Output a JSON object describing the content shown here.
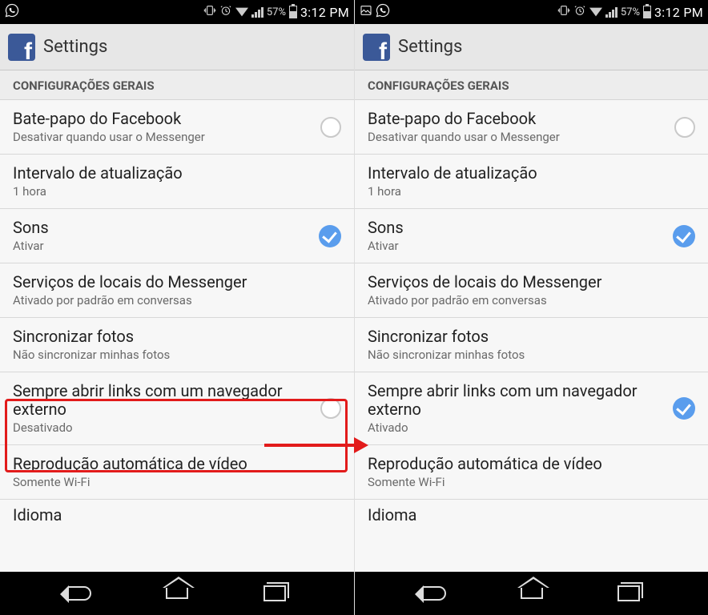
{
  "status": {
    "battery_pct": "57%",
    "time": "3:12 PM"
  },
  "header": {
    "title": "Settings"
  },
  "section_header": "CONFIGURAÇÕES GERAIS",
  "rows": {
    "chat": {
      "title": "Bate-papo do Facebook",
      "sub": "Desativar quando usar o Messenger"
    },
    "interval": {
      "title": "Intervalo de atualização",
      "sub": "1 hora"
    },
    "sounds": {
      "title": "Sons",
      "sub": "Ativar"
    },
    "location": {
      "title": "Serviços de locais do Messenger",
      "sub": "Ativado por padrão em conversas"
    },
    "syncphotos": {
      "title": "Sincronizar fotos",
      "sub": "Não sincronizar minhas fotos"
    },
    "extbrowser_off": {
      "title": "Sempre abrir links com um navegador externo",
      "sub": "Desativado"
    },
    "extbrowser_on": {
      "title": "Sempre abrir links com um navegador externo",
      "sub": "Ativado"
    },
    "autoplay": {
      "title": "Reprodução automática de vídeo",
      "sub": "Somente Wi-Fi"
    },
    "idioma": {
      "title": "Idioma"
    }
  }
}
